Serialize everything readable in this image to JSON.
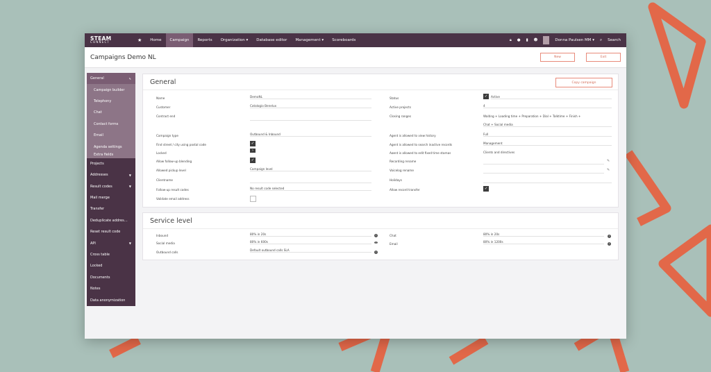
{
  "nav": {
    "logo_line1": "STEAM",
    "logo_line2": "CONNECT",
    "items": [
      "Home",
      "Campaign",
      "Reports",
      "Organization ▾",
      "Database editor",
      "Management ▾",
      "Scoreboards"
    ],
    "user": "Donna Paulsen MM ▾",
    "search": "Search"
  },
  "header": {
    "title": "Campaigns Demo NL",
    "new_button": "New",
    "exit_button": "Exit"
  },
  "sidebar": {
    "general": "General",
    "sub_items": [
      "Campaign builder",
      "Telephony",
      "Chat",
      "Contact forms",
      "Email",
      "Agenda settings",
      "Extra fields"
    ],
    "items": [
      "Projects",
      "Addresses",
      "Result codes",
      "Mail merge",
      "Transfer",
      "Deduplicate addres…",
      "Reset result code",
      "API",
      "Cross table",
      "Locked",
      "Documents",
      "Notes",
      "Data anonymization"
    ]
  },
  "general": {
    "title": "General",
    "copy_button": "Copy campaign",
    "left": [
      {
        "label": "Name",
        "value": "DemoNL"
      },
      {
        "label": "Customer",
        "value": "Catalogio Benelux"
      },
      {
        "label": "Contract end",
        "value": ""
      },
      {
        "label": "Campaign type",
        "value": "Outbound & Inbound"
      },
      {
        "label": "Find street / city using postal code",
        "value": ""
      },
      {
        "label": "Locked",
        "value": ""
      },
      {
        "label": "Allow follow-up blending",
        "value": ""
      },
      {
        "label": "Allowed pickup level",
        "value": "Campaign level"
      },
      {
        "label": "Clientname",
        "value": ""
      },
      {
        "label": "Follow-up result codes",
        "value": "No result code selected"
      },
      {
        "label": "Validate email address",
        "value": ""
      }
    ],
    "right": [
      {
        "label": "Status",
        "value": "Active"
      },
      {
        "label": "Active projects",
        "value": "4"
      },
      {
        "label": "Closing ranges",
        "value": "Waiting + Loading time + Preparation + Dial + Talktime + Finish +"
      },
      {
        "label": "",
        "value": "Chat + Social media"
      },
      {
        "label": "Agent is allowed to view history",
        "value": "Full"
      },
      {
        "label": "Agent is allowed to search inactive records",
        "value": "Management"
      },
      {
        "label": "Agent is allowed to edit fixed time stamps",
        "value": "Clients and directives"
      },
      {
        "label": "Recording rename",
        "value": ""
      },
      {
        "label": "Voicelog rename",
        "value": ""
      },
      {
        "label": "Holidays",
        "value": ""
      },
      {
        "label": "Allow record transfer",
        "value": ""
      }
    ]
  },
  "service_level": {
    "title": "Service level",
    "left": [
      {
        "label": "Inbound",
        "value": "80% in 20s"
      },
      {
        "label": "Social media",
        "value": "80% in 600s"
      },
      {
        "label": "Outbound calls",
        "value": "Default outbound calls SLA"
      }
    ],
    "right": [
      {
        "label": "Chat",
        "value": "80% in 20s"
      },
      {
        "label": "Email",
        "value": "80% in 1200s"
      }
    ]
  },
  "colors": {
    "nav_bg": "#4a3346",
    "accent": "#e26849",
    "backdrop": "#a9c0b9"
  }
}
